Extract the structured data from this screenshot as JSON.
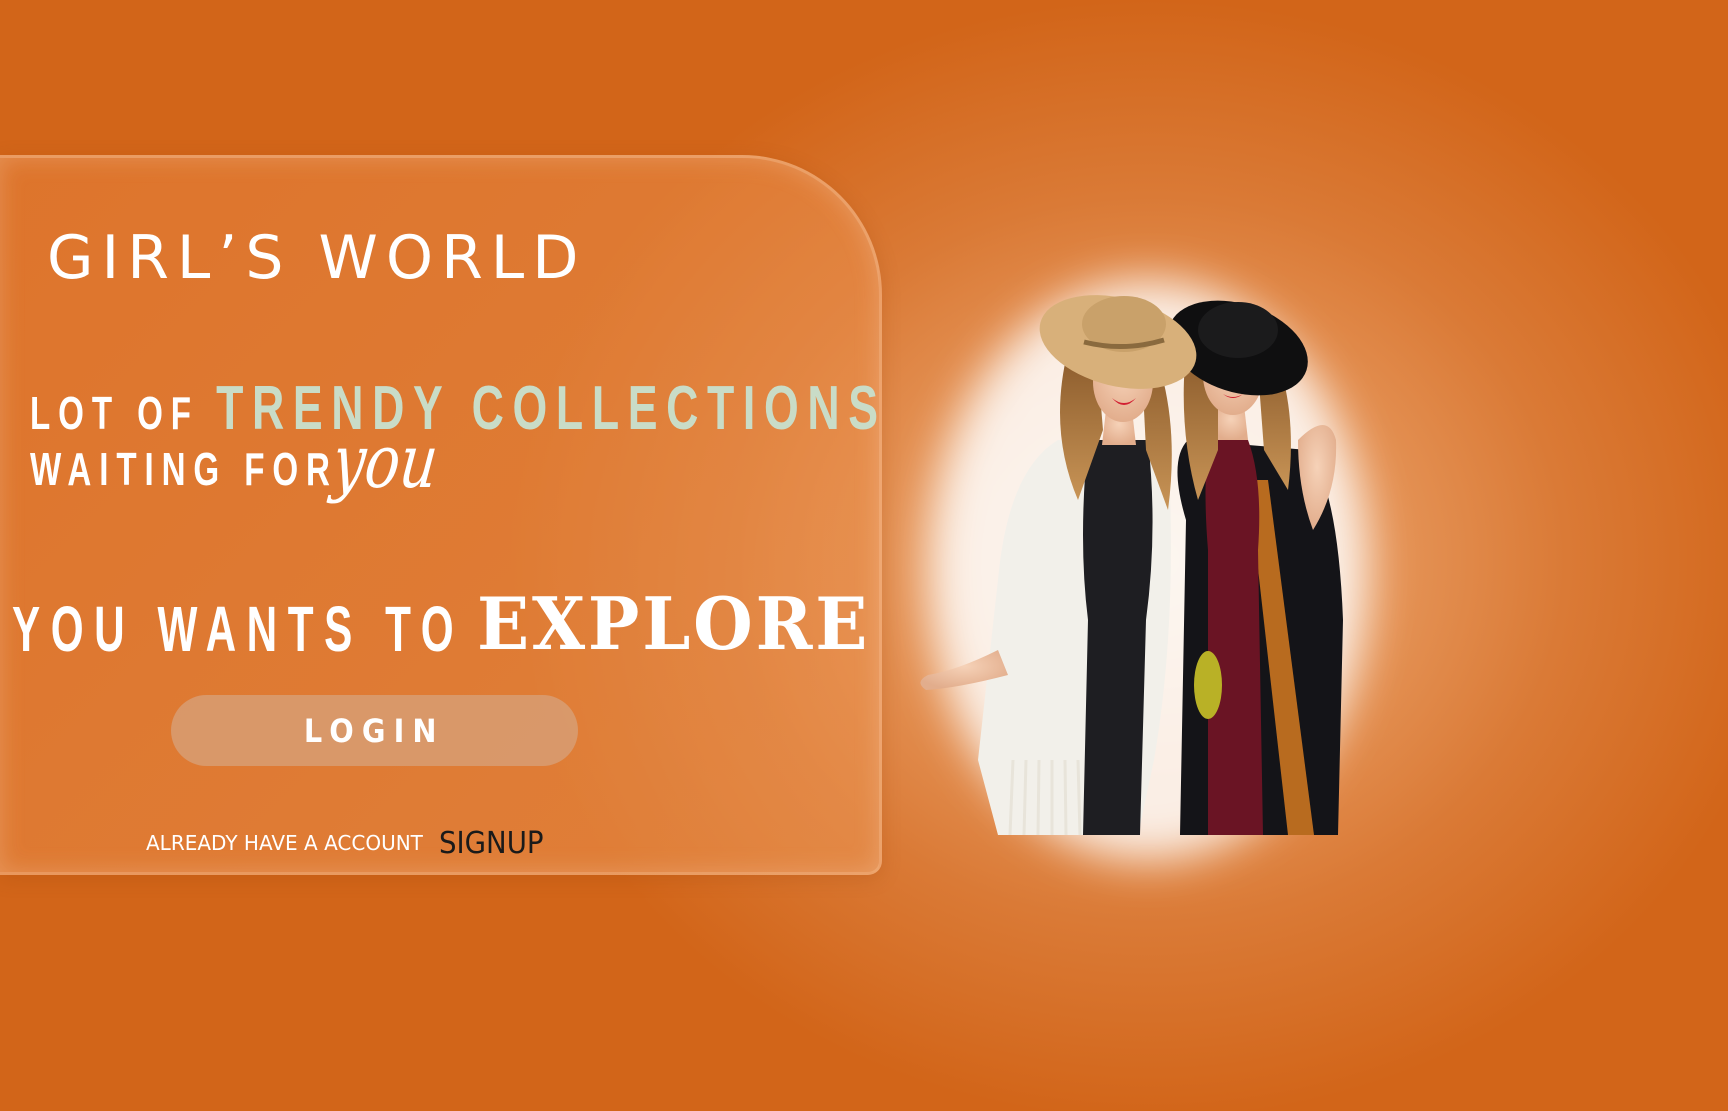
{
  "brand": {
    "title": "GIRL’S WORLD"
  },
  "hero": {
    "line1_lead": "LOT OF",
    "line1_accent": "TRENDY COLLECTIONS",
    "line2_lead": "WAITING FOR",
    "line2_script": "you",
    "line3_lead": "YOU WANTS TO",
    "line3_accent": "EXPLORE"
  },
  "actions": {
    "login_label": "LOGIN",
    "account_prompt": "ALREADY HAVE A ACCOUNT",
    "signup_label": "SIGNUP"
  },
  "image": {
    "icon": "fashion-models-photo"
  },
  "colors": {
    "background": "#d26519",
    "accent_text": "#c9dcc7",
    "login_button": "#d7a078",
    "signup_text": "#1a1a1a"
  }
}
